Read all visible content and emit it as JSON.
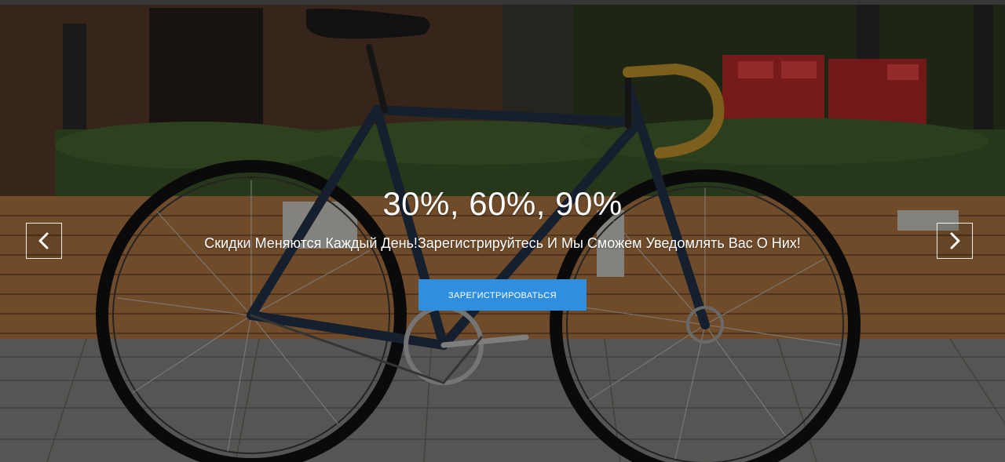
{
  "slide": {
    "headline": "30%, 60%, 90%",
    "subline": "Скидки Меняются Каждый День!Зарегистрируйтесь И Мы Сможем Уведомлять Вас О Них!",
    "cta_label": "ЗАРЕГИСТРИРОВАТЬСЯ"
  },
  "controls": {
    "prev_icon": "chevron-left-icon",
    "next_icon": "chevron-right-icon"
  },
  "colors": {
    "cta_background": "#2f8fde",
    "text": "#ffffff",
    "overlay": "rgba(0,0,0,0.38)"
  }
}
